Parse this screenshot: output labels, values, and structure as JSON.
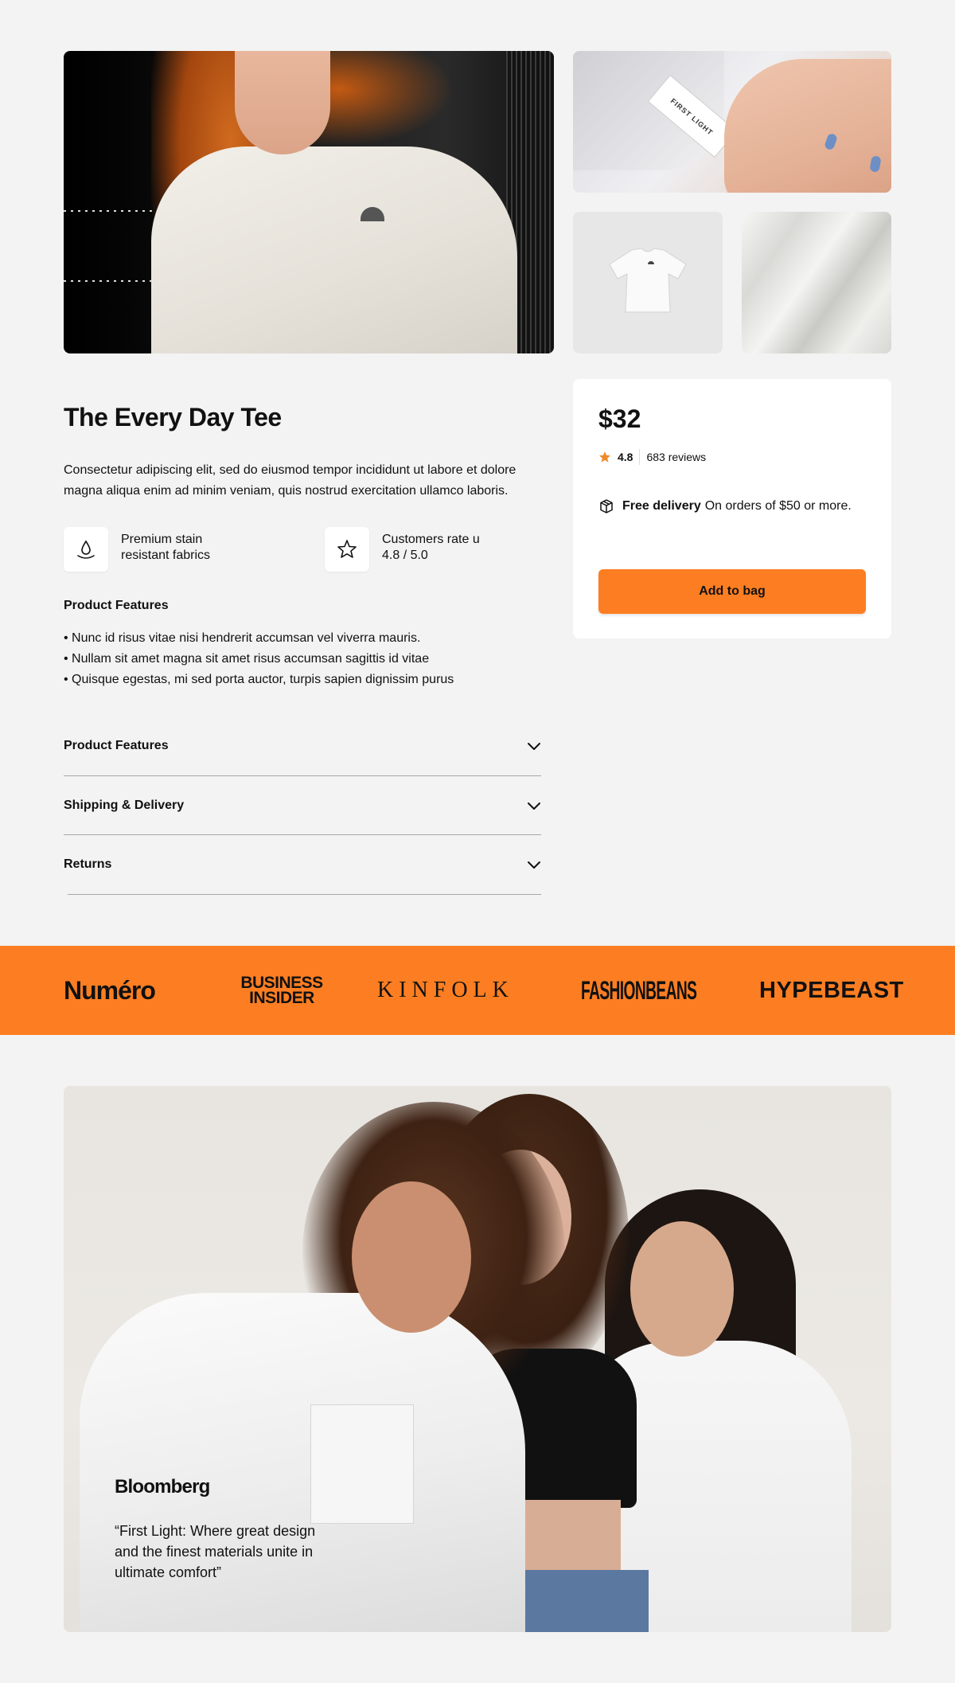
{
  "product": {
    "title": "The Every Day Tee",
    "description": "Consectetur adipiscing elit, sed do eiusmod tempor incididunt ut labore et dolore magna aliqua enim ad minim veniam, quis nostrud exercitation ullamco laboris.",
    "highlights": [
      {
        "icon": "water-drop-icon",
        "line1": "Premium stain",
        "line2": "resistant fabrics"
      },
      {
        "icon": "star-outline-icon",
        "line1": "Customers rate u",
        "line2": "4.8 / 5.0"
      }
    ],
    "features_heading": "Product Features",
    "features": [
      "• Nunc id risus vitae nisi hendrerit accumsan vel viverra mauris.",
      "• Nullam sit amet magna sit amet risus accumsan sagittis id vitae",
      "• Quisque egestas, mi sed porta auctor, turpis sapien dignissim purus"
    ],
    "accordions": [
      {
        "label": "Product Features",
        "icon": "chevron-down-icon"
      },
      {
        "label": "Shipping & Delivery",
        "icon": "chevron-down-icon"
      },
      {
        "label": "Returns",
        "icon": "chevron-down-icon"
      }
    ]
  },
  "purchase": {
    "price": "$32",
    "rating": "4.8",
    "reviews": "683 reviews",
    "delivery_bold": "Free delivery",
    "delivery_text": "On orders of $50 or more.",
    "add_to_bag": "Add to bag"
  },
  "press": {
    "logos": [
      "Numéro",
      "BUSINESS INSIDER",
      "KINFOLK",
      "FASHIONBEANS",
      "HYPEBEAST"
    ]
  },
  "hero": {
    "brand": "Bloomberg",
    "quote": "“First Light: Where great design and the finest materials unite in ultimate comfort”"
  },
  "gallery": {
    "tag_text": "FIRST LIGHT"
  },
  "colors": {
    "accent": "#fd7e22",
    "background": "#f3f3f3",
    "card": "#ffffff",
    "star": "#f08a2a"
  }
}
